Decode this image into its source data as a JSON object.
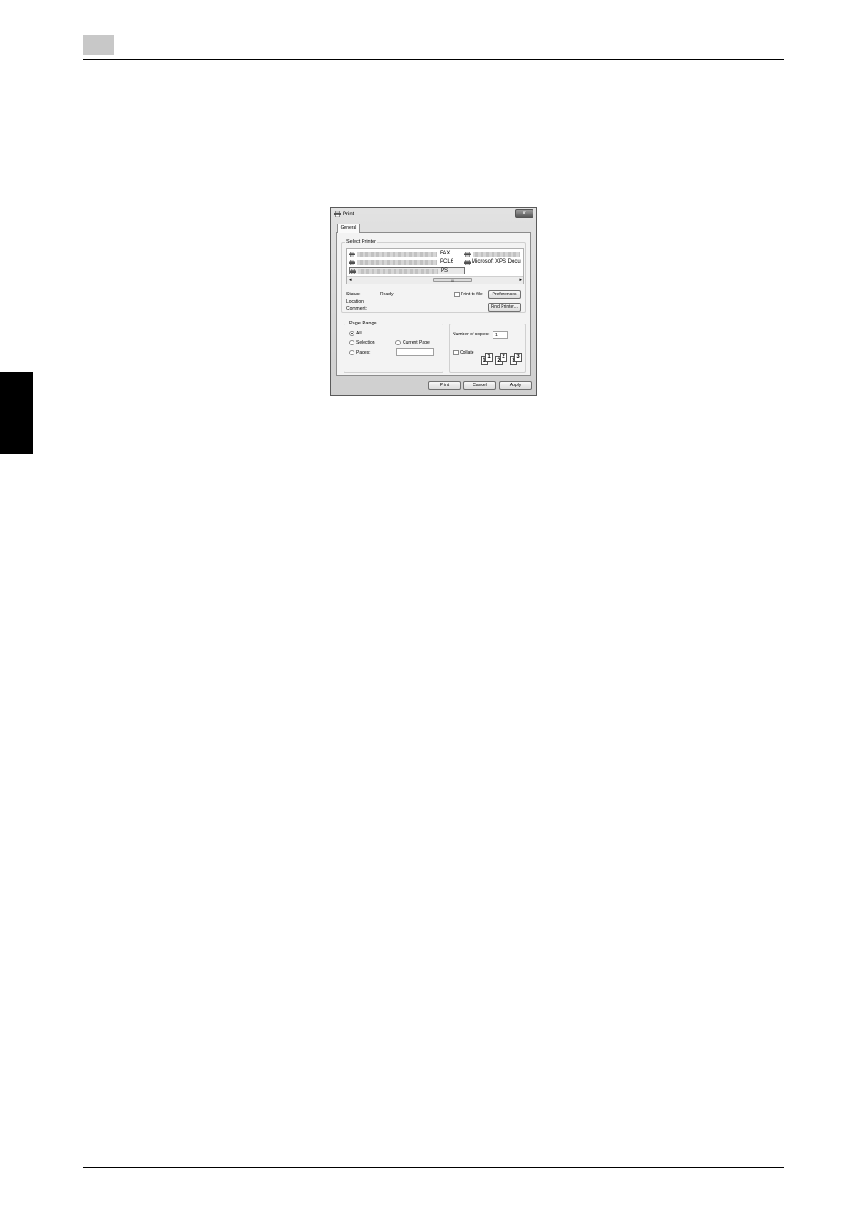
{
  "dialog": {
    "title": "Print",
    "close_glyph": "x",
    "tab_general": "General",
    "select_printer": {
      "label": "Select Printer",
      "items": [
        {
          "name": "FAX",
          "icon": "printer-icon"
        },
        {
          "name": "",
          "icon": "printer-icon"
        },
        {
          "name": "PCL6",
          "icon": "printer-icon"
        },
        {
          "name": "Microsoft XPS Docu",
          "icon": "printer-icon"
        },
        {
          "name": "PS",
          "icon": "printer-icon",
          "selected": true
        }
      ],
      "scroll_left": "◂",
      "scroll_right": "▸",
      "scroll_thumb": "III"
    },
    "status_label": "Status:",
    "status_value": "Ready",
    "location_label": "Location:",
    "comment_label": "Comment:",
    "print_to_file": "Print to file",
    "preferences_button": "Preferences",
    "find_printer_button": "Find Printer...",
    "page_range": {
      "label": "Page Range",
      "all": "All",
      "selection": "Selection",
      "current_page": "Current Page",
      "pages": "Pages:",
      "selected": "All"
    },
    "copies": {
      "label": "Number of copies:",
      "value": "1",
      "collate": "Collate",
      "collate_pages": [
        "1",
        "1",
        "2",
        "2",
        "3",
        "3"
      ]
    },
    "buttons": {
      "print": "Print",
      "cancel": "Cancel",
      "apply": "Apply"
    }
  },
  "colors": {
    "side_tab": "#000000",
    "chapter_box": "#c8c8c8"
  }
}
